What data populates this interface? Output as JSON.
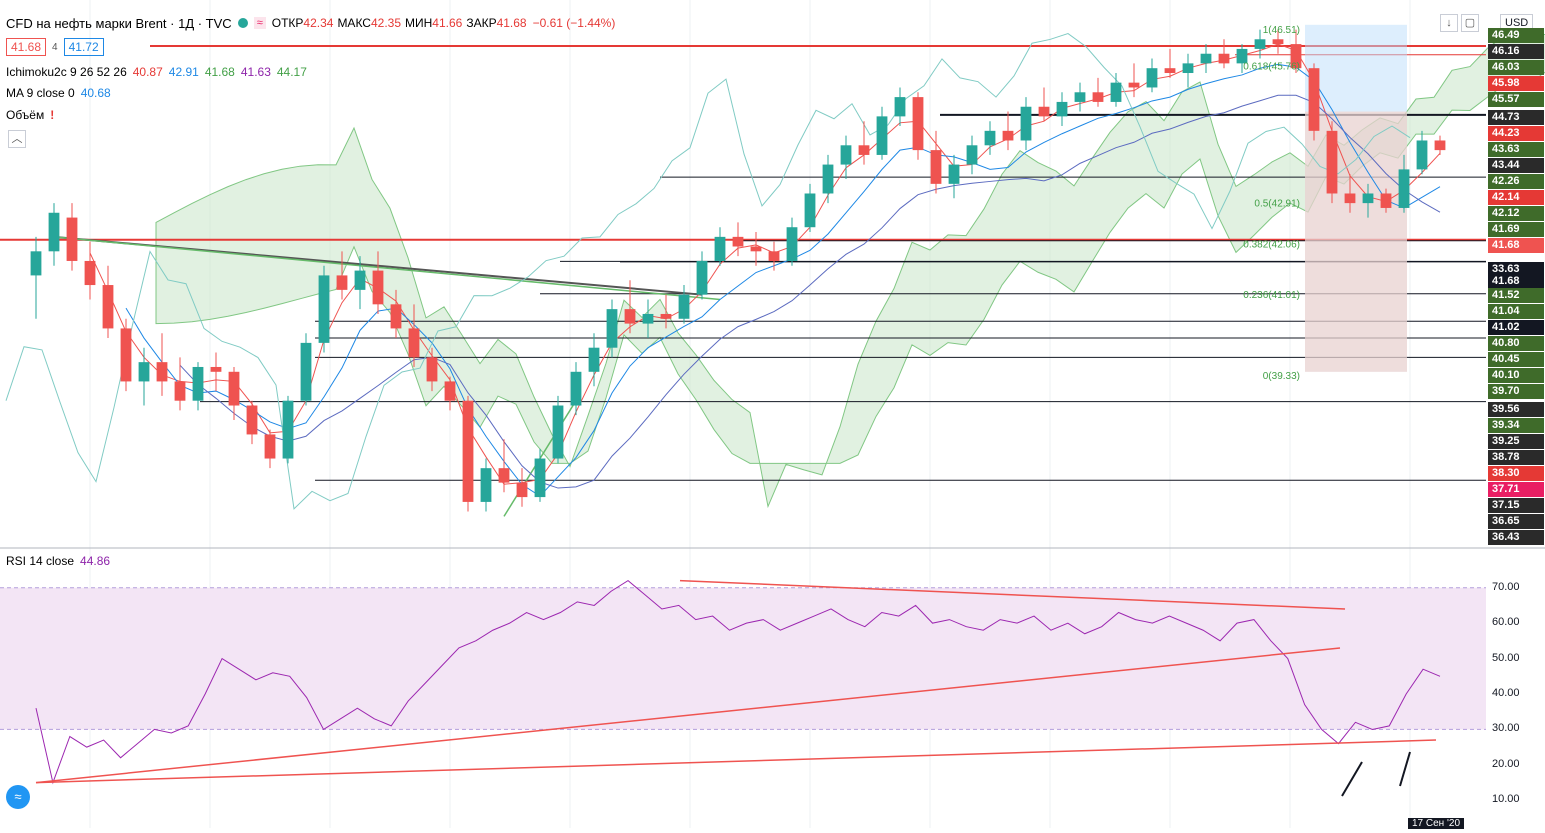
{
  "header": {
    "symbol_title": "CFD на нефть марки Brent · 1Д · TVC",
    "ohlc": [
      {
        "label": "ОТКР",
        "value": "42.34"
      },
      {
        "label": "МАКС",
        "value": "42.35"
      },
      {
        "label": "МИН",
        "value": "41.66"
      },
      {
        "label": "ЗАКР",
        "value": "41.68"
      }
    ],
    "change": "−0.61 (−1.44%)",
    "bid": "41.68",
    "spread": "4",
    "ask": "41.72"
  },
  "indicators": {
    "ichimoku": {
      "label": "Ichimoku2c 9 26 52 26",
      "values": [
        "40.87",
        "42.91",
        "41.68",
        "41.63",
        "44.17"
      ]
    },
    "ma": {
      "label": "MA 9 close 0",
      "value": "40.68"
    },
    "volume": {
      "label": "Объём",
      "marker": "!"
    },
    "rsi": {
      "label": "RSI 14 close",
      "value": "44.86"
    }
  },
  "currency": "USD",
  "price_axis_labels": [
    {
      "text": "46.49",
      "bg": "#3f6b2a",
      "fg": "#ffffff"
    },
    {
      "text": "46.16",
      "bg": "#2a2a2a",
      "fg": "#ffffff"
    },
    {
      "text": "46.03",
      "bg": "#3f6b2a",
      "fg": "#ffffff"
    },
    {
      "text": "45.98",
      "bg": "#e53935",
      "fg": "#ffffff"
    },
    {
      "text": "45.57",
      "bg": "#3f6b2a",
      "fg": "#ffffff"
    },
    {
      "text": "44.73",
      "bg": "#2a2a2a",
      "fg": "#ffffff"
    },
    {
      "text": "44.23",
      "bg": "#e53935",
      "fg": "#ffffff"
    },
    {
      "text": "43.63",
      "bg": "#3f6b2a",
      "fg": "#ffffff"
    },
    {
      "text": "43.44",
      "bg": "#2a2a2a",
      "fg": "#ffffff"
    },
    {
      "text": "42.26",
      "bg": "#3f6b2a",
      "fg": "#ffffff"
    },
    {
      "text": "42.14",
      "bg": "#e53935",
      "fg": "#ffffff"
    },
    {
      "text": "42.12",
      "bg": "#3f6b2a",
      "fg": "#ffffff"
    },
    {
      "text": "41.69",
      "bg": "#3f6b2a",
      "fg": "#ffffff"
    },
    {
      "text": "41.68",
      "bg": "#ef5350",
      "fg": "#ffffff"
    },
    {
      "text": "33.63",
      "bg": "#131722",
      "fg": "#ffffff"
    },
    {
      "text": "41.68",
      "bg": "#131722",
      "fg": "#ffffff"
    },
    {
      "text": "41.52",
      "bg": "#3f6b2a",
      "fg": "#ffffff"
    },
    {
      "text": "41.04",
      "bg": "#3f6b2a",
      "fg": "#ffffff"
    },
    {
      "text": "41.02",
      "bg": "#131722",
      "fg": "#ffffff"
    },
    {
      "text": "40.80",
      "bg": "#3f6b2a",
      "fg": "#ffffff"
    },
    {
      "text": "40.45",
      "bg": "#3f6b2a",
      "fg": "#ffffff"
    },
    {
      "text": "40.10",
      "bg": "#3f6b2a",
      "fg": "#ffffff"
    },
    {
      "text": "39.70",
      "bg": "#3f6b2a",
      "fg": "#ffffff"
    },
    {
      "text": "39.56",
      "bg": "#2a2a2a",
      "fg": "#ffffff"
    },
    {
      "text": "39.34",
      "bg": "#3f6b2a",
      "fg": "#ffffff"
    },
    {
      "text": "39.25",
      "bg": "#2a2a2a",
      "fg": "#ffffff"
    },
    {
      "text": "38.78",
      "bg": "#2a2a2a",
      "fg": "#ffffff"
    },
    {
      "text": "38.30",
      "bg": "#e53935",
      "fg": "#ffffff"
    },
    {
      "text": "37.71",
      "bg": "#e91e63",
      "fg": "#ffffff"
    },
    {
      "text": "37.15",
      "bg": "#2a2a2a",
      "fg": "#ffffff"
    },
    {
      "text": "36.65",
      "bg": "#2a2a2a",
      "fg": "#ffffff"
    },
    {
      "text": "36.43",
      "bg": "#2a2a2a",
      "fg": "#ffffff"
    }
  ],
  "fib_labels": [
    "1(46.51)",
    "0.618(45.76)",
    "0.5(42.91)",
    "0.382(42.06)",
    "0.236(41.01)",
    "0(39.33)"
  ],
  "rsi_axis": [
    "70.00",
    "60.00",
    "50.00",
    "40.00",
    "30.00",
    "20.00",
    "10.00"
  ],
  "date_label": "17 Сен '20",
  "colors": {
    "up": "#26a69a",
    "down": "#ef5350",
    "cloud": "#c8e6c9",
    "rsi_band": "#f3e5f5",
    "rsi_line": "#9c27b0"
  },
  "chart_data": {
    "type": "candlestick",
    "title": "CFD на нефть марки Brent · 1Д · TVC",
    "candles": [
      {
        "o": 41.4,
        "h": 42.2,
        "l": 40.5,
        "c": 41.9
      },
      {
        "o": 41.9,
        "h": 42.9,
        "l": 41.6,
        "c": 42.7
      },
      {
        "o": 42.6,
        "h": 42.9,
        "l": 41.5,
        "c": 41.7
      },
      {
        "o": 41.7,
        "h": 42.1,
        "l": 40.9,
        "c": 41.2
      },
      {
        "o": 41.2,
        "h": 41.6,
        "l": 40.1,
        "c": 40.3
      },
      {
        "o": 40.3,
        "h": 40.5,
        "l": 39.0,
        "c": 39.2
      },
      {
        "o": 39.2,
        "h": 39.9,
        "l": 38.7,
        "c": 39.6
      },
      {
        "o": 39.6,
        "h": 40.2,
        "l": 38.9,
        "c": 39.2
      },
      {
        "o": 39.2,
        "h": 39.7,
        "l": 38.6,
        "c": 38.8
      },
      {
        "o": 38.8,
        "h": 39.6,
        "l": 38.6,
        "c": 39.5
      },
      {
        "o": 39.5,
        "h": 39.8,
        "l": 39.0,
        "c": 39.4
      },
      {
        "o": 39.4,
        "h": 39.5,
        "l": 38.4,
        "c": 38.7
      },
      {
        "o": 38.7,
        "h": 38.8,
        "l": 37.9,
        "c": 38.1
      },
      {
        "o": 38.1,
        "h": 38.2,
        "l": 37.4,
        "c": 37.6
      },
      {
        "o": 37.6,
        "h": 38.9,
        "l": 37.5,
        "c": 38.8
      },
      {
        "o": 38.8,
        "h": 40.2,
        "l": 38.7,
        "c": 40.0
      },
      {
        "o": 40.0,
        "h": 41.6,
        "l": 39.8,
        "c": 41.4
      },
      {
        "o": 41.4,
        "h": 41.9,
        "l": 40.9,
        "c": 41.1
      },
      {
        "o": 41.1,
        "h": 41.8,
        "l": 40.7,
        "c": 41.5
      },
      {
        "o": 41.5,
        "h": 41.9,
        "l": 40.6,
        "c": 40.8
      },
      {
        "o": 40.8,
        "h": 41.1,
        "l": 40.1,
        "c": 40.3
      },
      {
        "o": 40.3,
        "h": 40.8,
        "l": 39.5,
        "c": 39.7
      },
      {
        "o": 39.7,
        "h": 39.9,
        "l": 39.0,
        "c": 39.2
      },
      {
        "o": 39.2,
        "h": 39.3,
        "l": 38.6,
        "c": 38.8
      },
      {
        "o": 38.8,
        "h": 38.9,
        "l": 36.5,
        "c": 36.7
      },
      {
        "o": 36.7,
        "h": 37.6,
        "l": 36.5,
        "c": 37.4
      },
      {
        "o": 37.4,
        "h": 38.0,
        "l": 36.9,
        "c": 37.1
      },
      {
        "o": 37.1,
        "h": 37.4,
        "l": 36.6,
        "c": 36.8
      },
      {
        "o": 36.8,
        "h": 37.8,
        "l": 36.7,
        "c": 37.6
      },
      {
        "o": 37.6,
        "h": 38.9,
        "l": 37.5,
        "c": 38.7
      },
      {
        "o": 38.7,
        "h": 39.6,
        "l": 38.5,
        "c": 39.4
      },
      {
        "o": 39.4,
        "h": 40.2,
        "l": 39.1,
        "c": 39.9
      },
      {
        "o": 39.9,
        "h": 40.9,
        "l": 39.7,
        "c": 40.7
      },
      {
        "o": 40.7,
        "h": 41.3,
        "l": 40.2,
        "c": 40.4
      },
      {
        "o": 40.4,
        "h": 40.9,
        "l": 40.1,
        "c": 40.6
      },
      {
        "o": 40.6,
        "h": 41.0,
        "l": 40.3,
        "c": 40.5
      },
      {
        "o": 40.5,
        "h": 41.2,
        "l": 40.4,
        "c": 41.0
      },
      {
        "o": 41.0,
        "h": 41.9,
        "l": 40.9,
        "c": 41.7
      },
      {
        "o": 41.7,
        "h": 42.4,
        "l": 41.6,
        "c": 42.2
      },
      {
        "o": 42.2,
        "h": 42.5,
        "l": 41.8,
        "c": 42.0
      },
      {
        "o": 42.0,
        "h": 42.3,
        "l": 41.6,
        "c": 41.9
      },
      {
        "o": 41.9,
        "h": 42.1,
        "l": 41.5,
        "c": 41.7
      },
      {
        "o": 41.7,
        "h": 42.6,
        "l": 41.6,
        "c": 42.4
      },
      {
        "o": 42.4,
        "h": 43.3,
        "l": 42.3,
        "c": 43.1
      },
      {
        "o": 43.1,
        "h": 43.9,
        "l": 42.9,
        "c": 43.7
      },
      {
        "o": 43.7,
        "h": 44.3,
        "l": 43.4,
        "c": 44.1
      },
      {
        "o": 44.1,
        "h": 44.6,
        "l": 43.7,
        "c": 43.9
      },
      {
        "o": 43.9,
        "h": 44.9,
        "l": 43.8,
        "c": 44.7
      },
      {
        "o": 44.7,
        "h": 45.3,
        "l": 44.5,
        "c": 45.1
      },
      {
        "o": 45.1,
        "h": 45.2,
        "l": 43.8,
        "c": 44.0
      },
      {
        "o": 44.0,
        "h": 44.4,
        "l": 43.1,
        "c": 43.3
      },
      {
        "o": 43.3,
        "h": 43.9,
        "l": 43.0,
        "c": 43.7
      },
      {
        "o": 43.7,
        "h": 44.3,
        "l": 43.5,
        "c": 44.1
      },
      {
        "o": 44.1,
        "h": 44.6,
        "l": 43.9,
        "c": 44.4
      },
      {
        "o": 44.4,
        "h": 44.8,
        "l": 44.0,
        "c": 44.2
      },
      {
        "o": 44.2,
        "h": 45.1,
        "l": 44.0,
        "c": 44.9
      },
      {
        "o": 44.9,
        "h": 45.3,
        "l": 44.6,
        "c": 44.7
      },
      {
        "o": 44.7,
        "h": 45.2,
        "l": 44.5,
        "c": 45.0
      },
      {
        "o": 45.0,
        "h": 45.4,
        "l": 44.8,
        "c": 45.2
      },
      {
        "o": 45.2,
        "h": 45.5,
        "l": 44.9,
        "c": 45.0
      },
      {
        "o": 45.0,
        "h": 45.6,
        "l": 44.9,
        "c": 45.4
      },
      {
        "o": 45.4,
        "h": 45.8,
        "l": 45.1,
        "c": 45.3
      },
      {
        "o": 45.3,
        "h": 45.9,
        "l": 45.2,
        "c": 45.7
      },
      {
        "o": 45.7,
        "h": 46.1,
        "l": 45.5,
        "c": 45.6
      },
      {
        "o": 45.6,
        "h": 46.0,
        "l": 45.3,
        "c": 45.8
      },
      {
        "o": 45.8,
        "h": 46.2,
        "l": 45.6,
        "c": 46.0
      },
      {
        "o": 46.0,
        "h": 46.3,
        "l": 45.7,
        "c": 45.8
      },
      {
        "o": 45.8,
        "h": 46.2,
        "l": 45.6,
        "c": 46.1
      },
      {
        "o": 46.1,
        "h": 46.5,
        "l": 45.9,
        "c": 46.3
      },
      {
        "o": 46.3,
        "h": 46.5,
        "l": 46.0,
        "c": 46.2
      },
      {
        "o": 46.2,
        "h": 46.5,
        "l": 45.6,
        "c": 45.7
      },
      {
        "o": 45.7,
        "h": 45.8,
        "l": 44.2,
        "c": 44.4
      },
      {
        "o": 44.4,
        "h": 44.6,
        "l": 42.9,
        "c": 43.1
      },
      {
        "o": 43.1,
        "h": 43.5,
        "l": 42.7,
        "c": 42.9
      },
      {
        "o": 42.9,
        "h": 43.3,
        "l": 42.6,
        "c": 43.1
      },
      {
        "o": 43.1,
        "h": 43.2,
        "l": 42.7,
        "c": 42.8
      },
      {
        "o": 42.8,
        "h": 43.9,
        "l": 42.7,
        "c": 43.6
      },
      {
        "o": 43.6,
        "h": 44.4,
        "l": 43.5,
        "c": 44.2
      },
      {
        "o": 44.2,
        "h": 44.3,
        "l": 43.9,
        "c": 44.0
      }
    ],
    "rsi": [
      36,
      15,
      28,
      25,
      27,
      22,
      26,
      30,
      29,
      31,
      40,
      50,
      47,
      44,
      46,
      45,
      39,
      30,
      33,
      36,
      33,
      31,
      38,
      43,
      48,
      53,
      55,
      58,
      60,
      63,
      61,
      63,
      66,
      65,
      69,
      72,
      68,
      64,
      65,
      61,
      62,
      58,
      60,
      61,
      58,
      60,
      62,
      64,
      61,
      59,
      63,
      62,
      65,
      60,
      61,
      59,
      58,
      61,
      60,
      62,
      58,
      60,
      57,
      59,
      63,
      61,
      60,
      62,
      60,
      58,
      55,
      60,
      61,
      55,
      50,
      37,
      30,
      26,
      32,
      30,
      31,
      40,
      47,
      45
    ],
    "rsi_ylim": [
      10,
      70
    ]
  }
}
